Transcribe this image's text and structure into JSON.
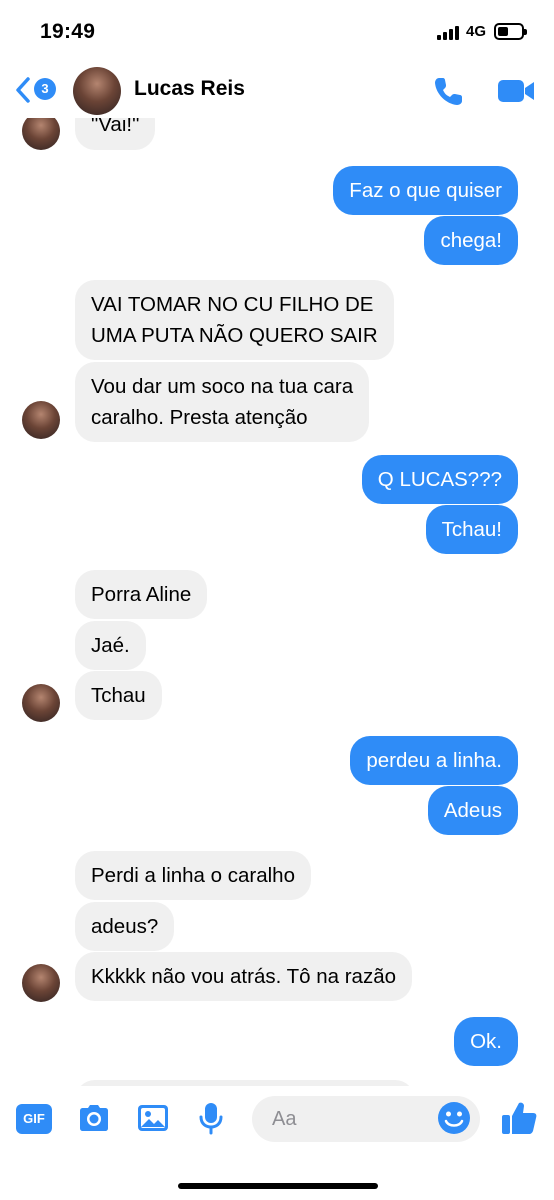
{
  "status_bar": {
    "time": "19:49",
    "network": "4G",
    "battery_level": 0.3
  },
  "header": {
    "unread_count": "3",
    "contact_name": "Lucas Reis",
    "accent_color": "#2f8cf7"
  },
  "messages": [
    {
      "side": "in",
      "text": "\"Vai!\""
    },
    {
      "side": "out",
      "text": "Faz o que quiser"
    },
    {
      "side": "out",
      "text": "chega!"
    },
    {
      "side": "in",
      "text": "VAI TOMAR NO CU FILHO DE",
      "text2": "UMA PUTA NÃO QUERO SAIR"
    },
    {
      "side": "in",
      "text": "Vou dar um soco na tua cara",
      "text2": "caralho. Presta atenção"
    },
    {
      "side": "out",
      "text": "Q LUCAS???"
    },
    {
      "side": "out",
      "text": "Tchau!"
    },
    {
      "side": "in",
      "text": "Porra Aline"
    },
    {
      "side": "in",
      "text": "Jaé."
    },
    {
      "side": "in",
      "text": "Tchau"
    },
    {
      "side": "out",
      "text": "perdeu a linha."
    },
    {
      "side": "out",
      "text": "Adeus"
    },
    {
      "side": "in",
      "text": "Perdi a linha o caralho"
    },
    {
      "side": "in",
      "text": "adeus?"
    },
    {
      "side": "in",
      "text": "Kkkkk não vou atrás. Tô na razão"
    },
    {
      "side": "out",
      "text": "Ok."
    }
  ],
  "composer": {
    "gif_label": "GIF",
    "placeholder": "Aa",
    "icons": [
      "camera-icon",
      "image-icon",
      "microphone-icon",
      "emoji-icon",
      "like-icon"
    ]
  }
}
